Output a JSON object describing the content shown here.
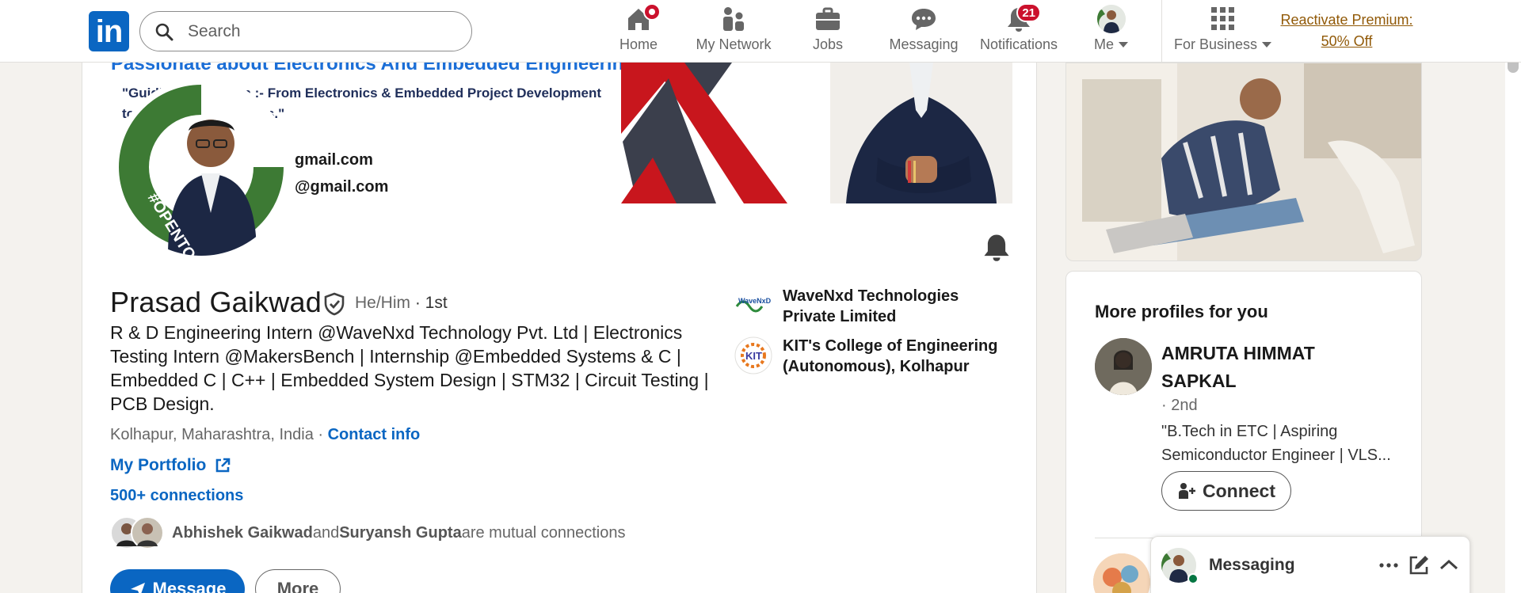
{
  "nav": {
    "logo_text": "in",
    "search_placeholder": "Search",
    "items": [
      {
        "label": "Home",
        "badge": ""
      },
      {
        "label": "My Network",
        "badge": ""
      },
      {
        "label": "Jobs",
        "badge": ""
      },
      {
        "label": "Messaging",
        "badge": ""
      },
      {
        "label": "Notifications",
        "badge": "21"
      },
      {
        "label": "Me",
        "badge": ""
      },
      {
        "label": "For Business",
        "badge": ""
      }
    ],
    "premium_line1": "Reactivate Premium:",
    "premium_line2": "50% Off"
  },
  "banner": {
    "title": "Passionate about Electronics And Embedded Engineering",
    "quote": "\"Guiding Innovation :- From Electronics & Embedded Project Development to Real-World Solutions.\"",
    "email1": "gmail.com",
    "email2": "@gmail.com",
    "opentowork": "#OPENTOWORK"
  },
  "profile": {
    "name": "Prasad Gaikwad",
    "pronouns": "He/Him",
    "degree": "· 1st",
    "headline": "R & D Engineering Intern @WaveNxd Technology Pvt. Ltd | Electronics Testing Intern @MakersBench | Internship @Embedded Systems & C | Embedded C | C++ | Embedded System Design | STM32 | Circuit Testing | PCB Design.",
    "location": "Kolhapur, Maharashtra, India",
    "location_sep": " · ",
    "contact_info": "Contact info",
    "portfolio": "My Portfolio",
    "connections": "500+ connections",
    "mutual_a": "Abhishek Gaikwad",
    "mutual_and": " and ",
    "mutual_b": "Suryansh Gupta",
    "mutual_suffix": " are mutual connections",
    "message_btn": "Message",
    "more_btn": "More"
  },
  "experience": [
    {
      "name": "WaveNxd Technologies Private Limited",
      "logo_text": "WaveNxD"
    },
    {
      "name": "KIT's College of Engineering (Autonomous), Kolhapur",
      "logo_text": "KIT"
    }
  ],
  "sidebar": {
    "more_title": "More profiles for you",
    "suggestion": {
      "name": "AMRUTA HIMMAT SAPKAL",
      "degree": "· 2nd",
      "headline": "\"B.Tech in ETC | Aspiring Semiconductor Engineer | VLS...",
      "connect": "Connect"
    }
  },
  "messaging": {
    "title": "Messaging"
  },
  "colors": {
    "brand": "#0a66c2",
    "badge": "#cb112d",
    "premium": "#915907",
    "open_to_work": "#3d7a34"
  }
}
